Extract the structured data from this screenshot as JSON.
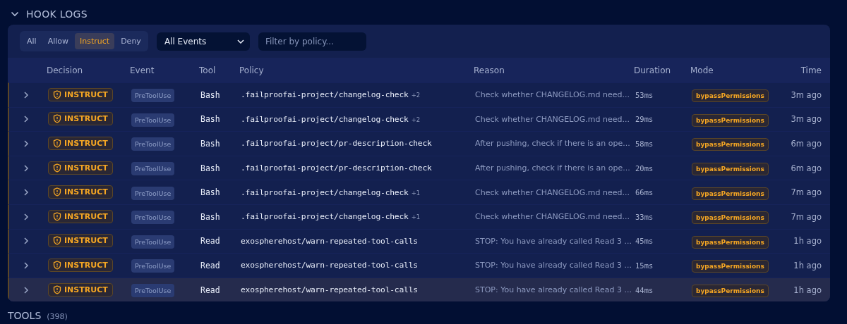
{
  "section": {
    "title": "HOOK LOGS",
    "expanded": true
  },
  "filters": {
    "tabs": [
      {
        "label": "All",
        "selected": false
      },
      {
        "label": "Allow",
        "selected": false
      },
      {
        "label": "Instruct",
        "selected": true
      },
      {
        "label": "Deny",
        "selected": false
      }
    ],
    "event_select": {
      "value": "All Events"
    },
    "policy_search": {
      "placeholder": "Filter by policy..."
    }
  },
  "table": {
    "columns": [
      "Decision",
      "Event",
      "Tool",
      "Policy",
      "Reason",
      "Duration",
      "Mode",
      "Time"
    ],
    "rows": [
      {
        "decision": "INSTRUCT",
        "kind": "instruct",
        "event": "PreToolUse",
        "tool": "Bash",
        "policy": ".failproofai-project/changelog-check",
        "policy_extra": "+2",
        "reason": "Check whether CHANGELOG.md need...",
        "duration": "53ms",
        "mode": "bypassPermissions",
        "time": "3m ago",
        "selected": false
      },
      {
        "decision": "INSTRUCT",
        "kind": "instruct",
        "event": "PreToolUse",
        "tool": "Bash",
        "policy": ".failproofai-project/changelog-check",
        "policy_extra": "+2",
        "reason": "Check whether CHANGELOG.md need...",
        "duration": "29ms",
        "mode": "bypassPermissions",
        "time": "3m ago",
        "selected": false
      },
      {
        "decision": "INSTRUCT",
        "kind": "instruct",
        "event": "PreToolUse",
        "tool": "Bash",
        "policy": ".failproofai-project/pr-description-check",
        "reason": "After pushing, check if there is an ope...",
        "duration": "58ms",
        "mode": "bypassPermissions",
        "time": "6m ago",
        "selected": false
      },
      {
        "decision": "INSTRUCT",
        "kind": "instruct",
        "event": "PreToolUse",
        "tool": "Bash",
        "policy": ".failproofai-project/pr-description-check",
        "reason": "After pushing, check if there is an ope...",
        "duration": "20ms",
        "mode": "bypassPermissions",
        "time": "6m ago",
        "selected": false
      },
      {
        "decision": "INSTRUCT",
        "kind": "instruct",
        "event": "PreToolUse",
        "tool": "Bash",
        "policy": ".failproofai-project/changelog-check",
        "policy_extra": "+1",
        "reason": "Check whether CHANGELOG.md need...",
        "duration": "66ms",
        "mode": "bypassPermissions",
        "time": "7m ago",
        "selected": false
      },
      {
        "decision": "INSTRUCT",
        "kind": "instruct",
        "event": "PreToolUse",
        "tool": "Bash",
        "policy": ".failproofai-project/changelog-check",
        "policy_extra": "+1",
        "reason": "Check whether CHANGELOG.md need...",
        "duration": "33ms",
        "mode": "bypassPermissions",
        "time": "7m ago",
        "selected": false
      },
      {
        "decision": "INSTRUCT",
        "kind": "instruct",
        "event": "PreToolUse",
        "tool": "Read",
        "policy": "exospherehost/warn-repeated-tool-calls",
        "reason": "STOP: You have already called Read 3 ...",
        "duration": "45ms",
        "mode": "bypassPermissions",
        "time": "1h ago",
        "selected": false
      },
      {
        "decision": "INSTRUCT",
        "kind": "instruct",
        "event": "PreToolUse",
        "tool": "Read",
        "policy": "exospherehost/warn-repeated-tool-calls",
        "reason": "STOP: You have already called Read 3 ...",
        "duration": "15ms",
        "mode": "bypassPermissions",
        "time": "1h ago",
        "selected": false
      },
      {
        "decision": "INSTRUCT",
        "kind": "instruct",
        "event": "PreToolUse",
        "tool": "Read",
        "policy": "exospherehost/warn-repeated-tool-calls",
        "reason": "STOP: You have already called Read 3 ...",
        "duration": "44ms",
        "mode": "bypassPermissions",
        "time": "1h ago",
        "selected": true
      }
    ]
  },
  "next_section": {
    "title": "TOOLS",
    "count": "(398)"
  }
}
